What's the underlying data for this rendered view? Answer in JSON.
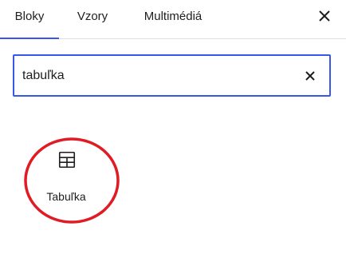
{
  "tabs": [
    {
      "label": "Bloky",
      "active": true
    },
    {
      "label": "Vzory",
      "active": false
    },
    {
      "label": "Multimédiá",
      "active": false
    }
  ],
  "close_icon": "close-icon",
  "search": {
    "value": "tabuľka",
    "placeholder": "",
    "clear_icon": "close-icon"
  },
  "results": [
    {
      "label": "Tabuľka",
      "icon": "table-icon"
    }
  ],
  "colors": {
    "accent": "#3858e9",
    "annotation": "#e01b24"
  }
}
